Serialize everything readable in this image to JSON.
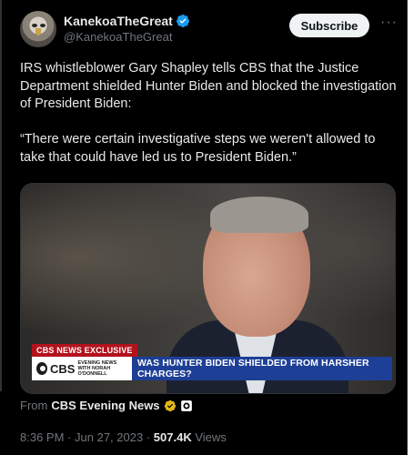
{
  "author": {
    "display_name": "KanekoaTheGreat",
    "handle": "@KanekoaTheGreat"
  },
  "actions": {
    "subscribe_label": "Subscribe",
    "more_label": "···"
  },
  "tweet": {
    "text": "IRS whistleblower Gary Shapley tells CBS that the Justice Department shielded Hunter Biden and blocked the investigation of President Biden:\n\n“There were certain investigative steps we weren't allowed to take that could have led us to President Biden.”"
  },
  "media": {
    "exclusive_tag": "CBS NEWS EXCLUSIVE",
    "logo_word": "CBS",
    "logo_sub_top": "EVENING NEWS",
    "logo_sub_bottom": "WITH NORAH O'DONNELL",
    "headline": "WAS HUNTER BIDEN SHIELDED FROM HARSHER CHARGES?"
  },
  "source": {
    "from_label": "From",
    "name": "CBS Evening News"
  },
  "meta": {
    "time": "8:36 PM",
    "date": "Jun 27, 2023",
    "separator": "·",
    "views_count": "507.4K",
    "views_label": "Views"
  },
  "colors": {
    "background": "#000000",
    "verified_blue": "#1d9bf0",
    "verified_gold": "#e2b719",
    "cbs_red": "#b3121d",
    "chyron_blue": "#1e3f96"
  }
}
